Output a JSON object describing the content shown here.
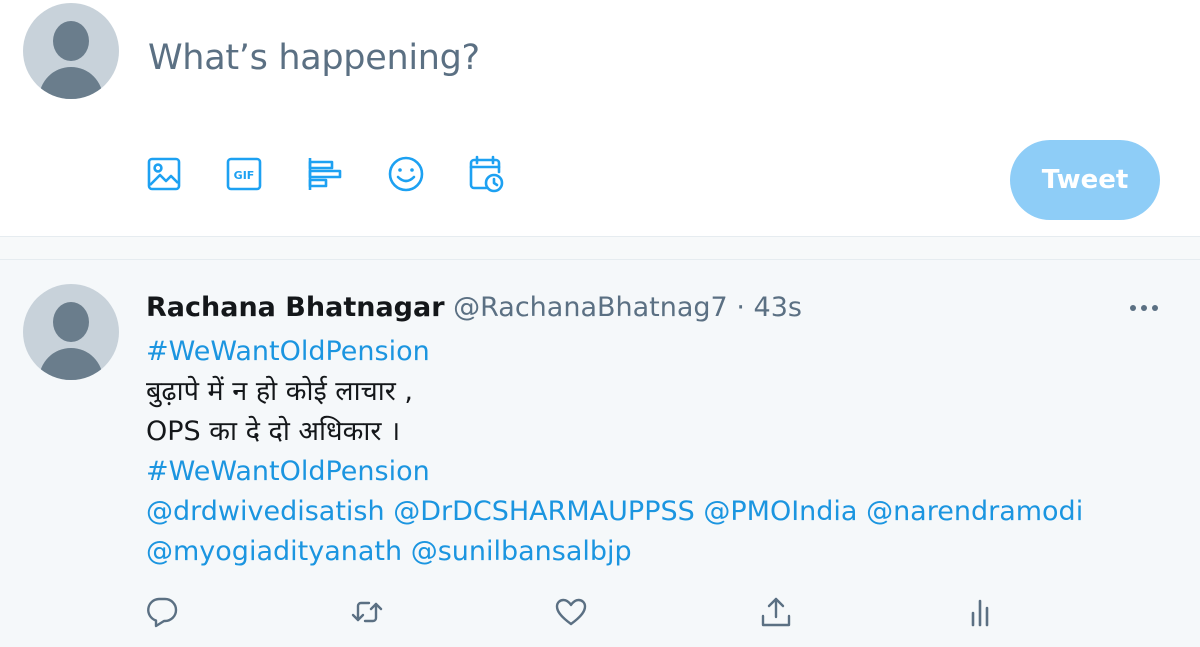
{
  "composer": {
    "prompt": "What’s happening?",
    "tweet_button": "Tweet",
    "icons": [
      "image-icon",
      "gif-icon",
      "poll-icon",
      "emoji-icon",
      "schedule-icon"
    ],
    "gif_label": "GIF"
  },
  "tweet": {
    "author_name": "Rachana Bhatnagar",
    "handle": "@RachanaBhatnag7",
    "separator": "·",
    "time": "43s",
    "hashtag1": "#WeWantOldPension",
    "text_line1": "बुढ़ापे में न हो कोई लाचार ,",
    "text_line2": "OPS का दे दो अधिकार ।",
    "hashtag2": "#WeWantOldPension",
    "mentions": [
      "@drdwivedisatish",
      "@DrDCSHARMAUPPSS",
      "@PMOIndia",
      "@narendramodi",
      "@myogiadityanath",
      "@sunilbansalbjp"
    ],
    "action_icons": [
      "reply-icon",
      "retweet-icon",
      "like-icon",
      "share-icon",
      "analytics-icon"
    ]
  },
  "colors": {
    "accent": "#1da1f2",
    "link": "#1b95e0",
    "tweet_button_disabled": "#8ecdf7",
    "secondary_text": "#5b7083"
  }
}
